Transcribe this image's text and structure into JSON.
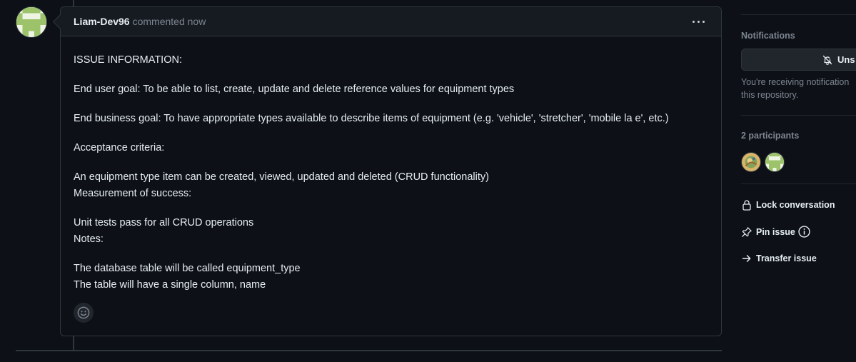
{
  "comment": {
    "author": "Liam-Dev96",
    "meta": "commented now",
    "body": {
      "p1": "ISSUE INFORMATION:",
      "p2": "End user goal: To be able to list, create, update and delete reference values for equipment types",
      "p3": "End business goal: To have appropriate types available to describe items of equipment (e.g. 'vehicle', 'stretcher', 'mobile la e', etc.)",
      "p4": "Acceptance criteria:",
      "p5a": "An equipment type item can be created, viewed, updated and deleted (CRUD functionality)",
      "p5b": "Measurement of success:",
      "p6a": "Unit tests pass for all CRUD operations",
      "p6b": "Notes:",
      "p7a": "The database table will be called equipment_type",
      "p7b": "The table will have a single column, name"
    }
  },
  "sidebar": {
    "notifications": {
      "heading": "Notifications",
      "button_label": "Uns",
      "description_line1": "You're receiving notification",
      "description_line2": "this repository."
    },
    "participants": {
      "heading": "2 participants"
    },
    "actions": {
      "lock": "Lock conversation",
      "pin": "Pin issue",
      "transfer": "Transfer issue"
    }
  },
  "icons": {
    "kebab": "kebab-horizontal-icon",
    "smiley": "smiley-icon",
    "bell_slash": "bell-slash-icon",
    "lock": "lock-icon",
    "pin": "pin-icon",
    "info": "info-icon",
    "arrow_right": "arrow-right-icon"
  },
  "colors": {
    "background": "#0d1117",
    "header_bg": "#161b22",
    "border": "#30363d",
    "muted_text": "#7d8590",
    "avatar_green": "#9cc26a"
  }
}
